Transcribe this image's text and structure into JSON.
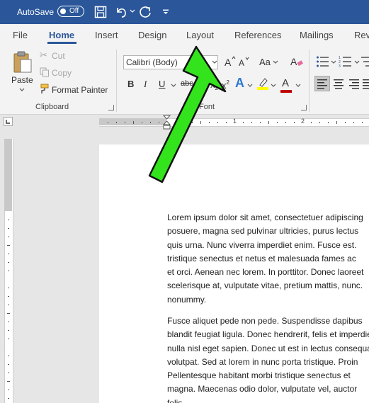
{
  "title_bar": {
    "autosave_label": "AutoSave",
    "autosave_state": "Off",
    "icons": [
      "save-icon",
      "undo-icon",
      "redo-icon",
      "customize-qat-icon"
    ]
  },
  "tabs": [
    "File",
    "Home",
    "Insert",
    "Design",
    "Layout",
    "References",
    "Mailings",
    "Rev"
  ],
  "active_tab": "Home",
  "clipboard": {
    "paste": "Paste",
    "cut": "Cut",
    "copy": "Copy",
    "format_painter": "Format Painter",
    "group_label": "Clipboard"
  },
  "font": {
    "font_name": "Calibri (Body)",
    "group_label": "Font",
    "bold": "B",
    "italic": "I",
    "underline": "U",
    "strikethrough": "abc",
    "subscript": "x",
    "superscript": "x",
    "change_case": "Aa",
    "text_effects": "A",
    "font_color": "A"
  },
  "ruler": {
    "mark_1": "1",
    "mark_2": "2"
  },
  "document": {
    "paragraphs": [
      [
        "Lorem ipsum dolor sit amet, consectetuer adipiscing",
        "posuere, magna sed pulvinar ultricies, purus lectus",
        "quis urna. Nunc viverra imperdiet enim. Fusce est.",
        "tristique senectus et netus et malesuada fames ac",
        "et orci. Aenean nec lorem. In porttitor. Donec laoreet",
        "scelerisque at, vulputate vitae, pretium mattis, nunc.",
        "nonummy."
      ],
      [
        "Fusce aliquet pede non pede. Suspendisse dapibus",
        "blandit feugiat ligula. Donec hendrerit, felis et imperdiet",
        "nulla nisl eget sapien. Donec ut est in lectus consequat",
        "volutpat. Sed at lorem in nunc porta tristique. Proin",
        "Pellentesque habitant morbi tristique senectus et",
        "magna. Maecenas odio dolor, vulputate vel, auctor",
        "felis."
      ]
    ]
  },
  "colors": {
    "title_bar": "#2b579a",
    "arrow_fill": "#33e31c",
    "highlight": "#ffff00",
    "font_color": "#c00000"
  }
}
